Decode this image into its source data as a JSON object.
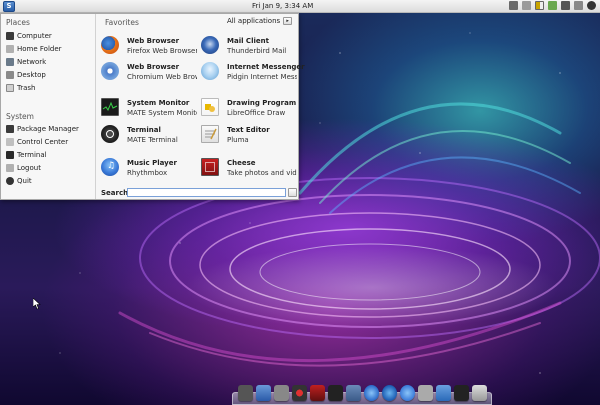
{
  "panel": {
    "menu_glyph": "S",
    "clock": "Fri Jan  9,  3:34 AM"
  },
  "places": {
    "title": "Places",
    "items": [
      {
        "label": "Computer",
        "icon": "computer-icon"
      },
      {
        "label": "Home Folder",
        "icon": "home-folder-icon"
      },
      {
        "label": "Network",
        "icon": "network-icon"
      },
      {
        "label": "Desktop",
        "icon": "desktop-icon"
      },
      {
        "label": "Trash",
        "icon": "trash-icon"
      }
    ]
  },
  "system": {
    "title": "System",
    "items": [
      {
        "label": "Package Manager",
        "icon": "package-manager-icon"
      },
      {
        "label": "Control Center",
        "icon": "control-center-icon"
      },
      {
        "label": "Terminal",
        "icon": "terminal-icon"
      },
      {
        "label": "Logout",
        "icon": "logout-icon"
      },
      {
        "label": "Quit",
        "icon": "quit-icon"
      }
    ]
  },
  "favorites": {
    "title": "Favorites",
    "all_apps_label": "All applications",
    "items": [
      {
        "name": "Web Browser",
        "desc": "Firefox Web Browser",
        "icon": "firefox-icon"
      },
      {
        "name": "Mail Client",
        "desc": "Thunderbird Mail",
        "icon": "thunderbird-icon"
      },
      {
        "name": "Web Browser",
        "desc": "Chromium Web Brow...",
        "icon": "chromium-icon"
      },
      {
        "name": "Internet Messenger",
        "desc": "Pidgin Internet Mess...",
        "icon": "pidgin-icon"
      },
      {
        "name": "System Monitor",
        "desc": "MATE System Monitor",
        "icon": "system-monitor-icon"
      },
      {
        "name": "Drawing Program",
        "desc": "LibreOffice Draw",
        "icon": "libreoffice-draw-icon"
      },
      {
        "name": "Terminal",
        "desc": "MATE Terminal",
        "icon": "mate-terminal-icon"
      },
      {
        "name": "Text Editor",
        "desc": "Pluma",
        "icon": "pluma-icon"
      },
      {
        "name": "Music Player",
        "desc": "Rhythmbox",
        "icon": "rhythmbox-icon"
      },
      {
        "name": "Cheese",
        "desc": "Take photos and vid...",
        "icon": "cheese-icon"
      }
    ]
  },
  "search": {
    "label": "Search:",
    "value": ""
  },
  "colors": {
    "accent": "#2a5ea8",
    "menu_bg": "#f6f6f6",
    "panel_bg": "#e4e4e4"
  }
}
